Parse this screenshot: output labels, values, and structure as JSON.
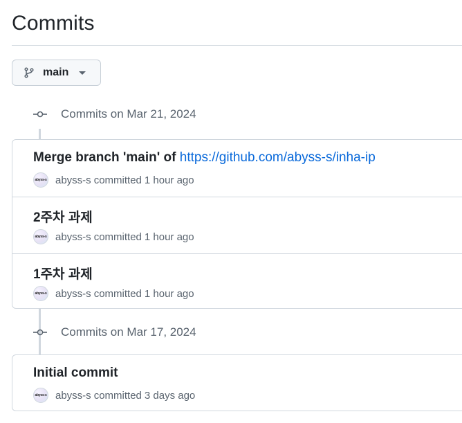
{
  "page": {
    "title": "Commits"
  },
  "branch_selector": {
    "icon": "git-branch-icon",
    "label": "main",
    "caret": "triangle-down-icon"
  },
  "groups": [
    {
      "header": "Commits on Mar 21, 2024",
      "commits": [
        {
          "title_text": "Merge branch 'main' of ",
          "title_link": "https://github.com/abyss-s/inha-ip",
          "author": "abyss-s",
          "action": "committed",
          "time": "1 hour ago",
          "avatar_text": "abyss-s"
        },
        {
          "title_text": "2주차 과제",
          "title_link": "",
          "author": "abyss-s",
          "action": "committed",
          "time": "1 hour ago",
          "avatar_text": "abyss-s"
        },
        {
          "title_text": "1주차 과제",
          "title_link": "",
          "author": "abyss-s",
          "action": "committed",
          "time": "1 hour ago",
          "avatar_text": "abyss-s"
        }
      ]
    },
    {
      "header": "Commits on Mar 17, 2024",
      "commits": [
        {
          "title_text": "Initial commit",
          "title_link": "",
          "author": "abyss-s",
          "action": "committed",
          "time": "3 days ago",
          "avatar_text": "abyss-s"
        }
      ]
    }
  ],
  "colors": {
    "link": "#0969da",
    "muted": "#59636e",
    "border": "#d0d7de",
    "button_bg": "#f6f8fa"
  }
}
